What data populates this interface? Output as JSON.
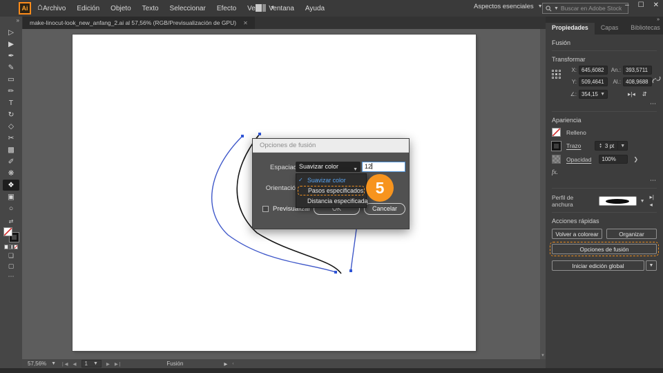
{
  "menubar": {
    "menus": [
      "Archivo",
      "Edición",
      "Objeto",
      "Texto",
      "Seleccionar",
      "Efecto",
      "Ver",
      "Ventana",
      "Ayuda"
    ],
    "logo_text": "Ai",
    "workspace": "Aspectos esenciales",
    "search_placeholder": "Buscar en Adobe Stock",
    "window_minimize": "–",
    "window_maximize": "☐",
    "window_close": "✕"
  },
  "document_tab": {
    "title": "make-linocut-look_new_anfang_2.ai al 57,56% (RGB/Previsualización de GPU)",
    "close": "✕"
  },
  "toolbar": {
    "collapse": "»",
    "tools": [
      {
        "name": "selection-tool",
        "glyph": "▷"
      },
      {
        "name": "direct-selection-tool",
        "glyph": "▶"
      },
      {
        "name": "pen-tool",
        "glyph": "✒"
      },
      {
        "name": "curvature-tool",
        "glyph": "✎"
      },
      {
        "name": "rectangle-tool",
        "glyph": "▭"
      },
      {
        "name": "paintbrush-tool",
        "glyph": "✏"
      },
      {
        "name": "type-tool",
        "glyph": "T"
      },
      {
        "name": "rotate-tool",
        "glyph": "↻"
      },
      {
        "name": "shaper-tool",
        "glyph": "◇"
      },
      {
        "name": "scissors-tool",
        "glyph": "✂"
      },
      {
        "name": "gradient-tool",
        "glyph": "▩"
      },
      {
        "name": "eyedropper-tool",
        "glyph": "✐"
      },
      {
        "name": "symbol-sprayer-tool",
        "glyph": "❋"
      },
      {
        "name": "blend-tool",
        "glyph": "❖",
        "selected": true
      },
      {
        "name": "artboard-tool",
        "glyph": "▣"
      },
      {
        "name": "zoom-tool",
        "glyph": "○"
      }
    ],
    "more": "⋯"
  },
  "canvas": {
    "colors": {
      "path_blue": "#3E57C9",
      "path_black": "#161616",
      "anchor": "#2F55D6"
    }
  },
  "dialog": {
    "title": "Opciones de fusión",
    "spacing_label": "Espaciado:",
    "spacing_value": "Suavizar color",
    "steps_value": "12",
    "orientation_label": "Orientación:",
    "menu_items": [
      {
        "label": "Suavizar color",
        "checked": true,
        "style": "blue"
      },
      {
        "label": "Pasos especificados",
        "style": "dashed"
      },
      {
        "label": "Distancia especificada",
        "style": ""
      }
    ],
    "preview_label": "Previsualizar",
    "ok_label": "OK",
    "cancel_label": "Cancelar"
  },
  "badge": {
    "number": "5",
    "color": "#F7941E"
  },
  "panel": {
    "collapse": "»",
    "tabs": [
      {
        "label": "Propiedades",
        "active": true
      },
      {
        "label": "Capas",
        "active": false
      },
      {
        "label": "Bibliotecas",
        "active": false
      }
    ],
    "selection_type": "Fusión",
    "transform": {
      "title": "Transformar",
      "x_label": "X:",
      "x_value": "645,6082",
      "y_label": "Y:",
      "y_value": "509,4641",
      "w_label": "An.:",
      "w_value": "393,5711",
      "h_label": "Al.:",
      "h_value": "408,9688",
      "angle_label": "∠:",
      "angle_value": "354,15",
      "more": "⋯"
    },
    "appearance": {
      "title": "Apariencia",
      "fill_label": "Relleno",
      "stroke_label": "Trazo",
      "stroke_weight": "3 pt",
      "opacity_label": "Opacidad",
      "opacity_value": "100%",
      "fx_label": "fx.",
      "more": "⋯",
      "width_profile_label": "Perfil de anchura"
    },
    "quick_actions": {
      "title": "Acciones rápidas",
      "recolor_label": "Volver a colorear",
      "arrange_label": "Organizar",
      "blend_options_label": "Opciones de fusión",
      "global_edit_label": "Iniciar edición global"
    }
  },
  "statusbar": {
    "zoom": "57,56%",
    "artboard_number": "1",
    "tool_name": "Fusión"
  }
}
